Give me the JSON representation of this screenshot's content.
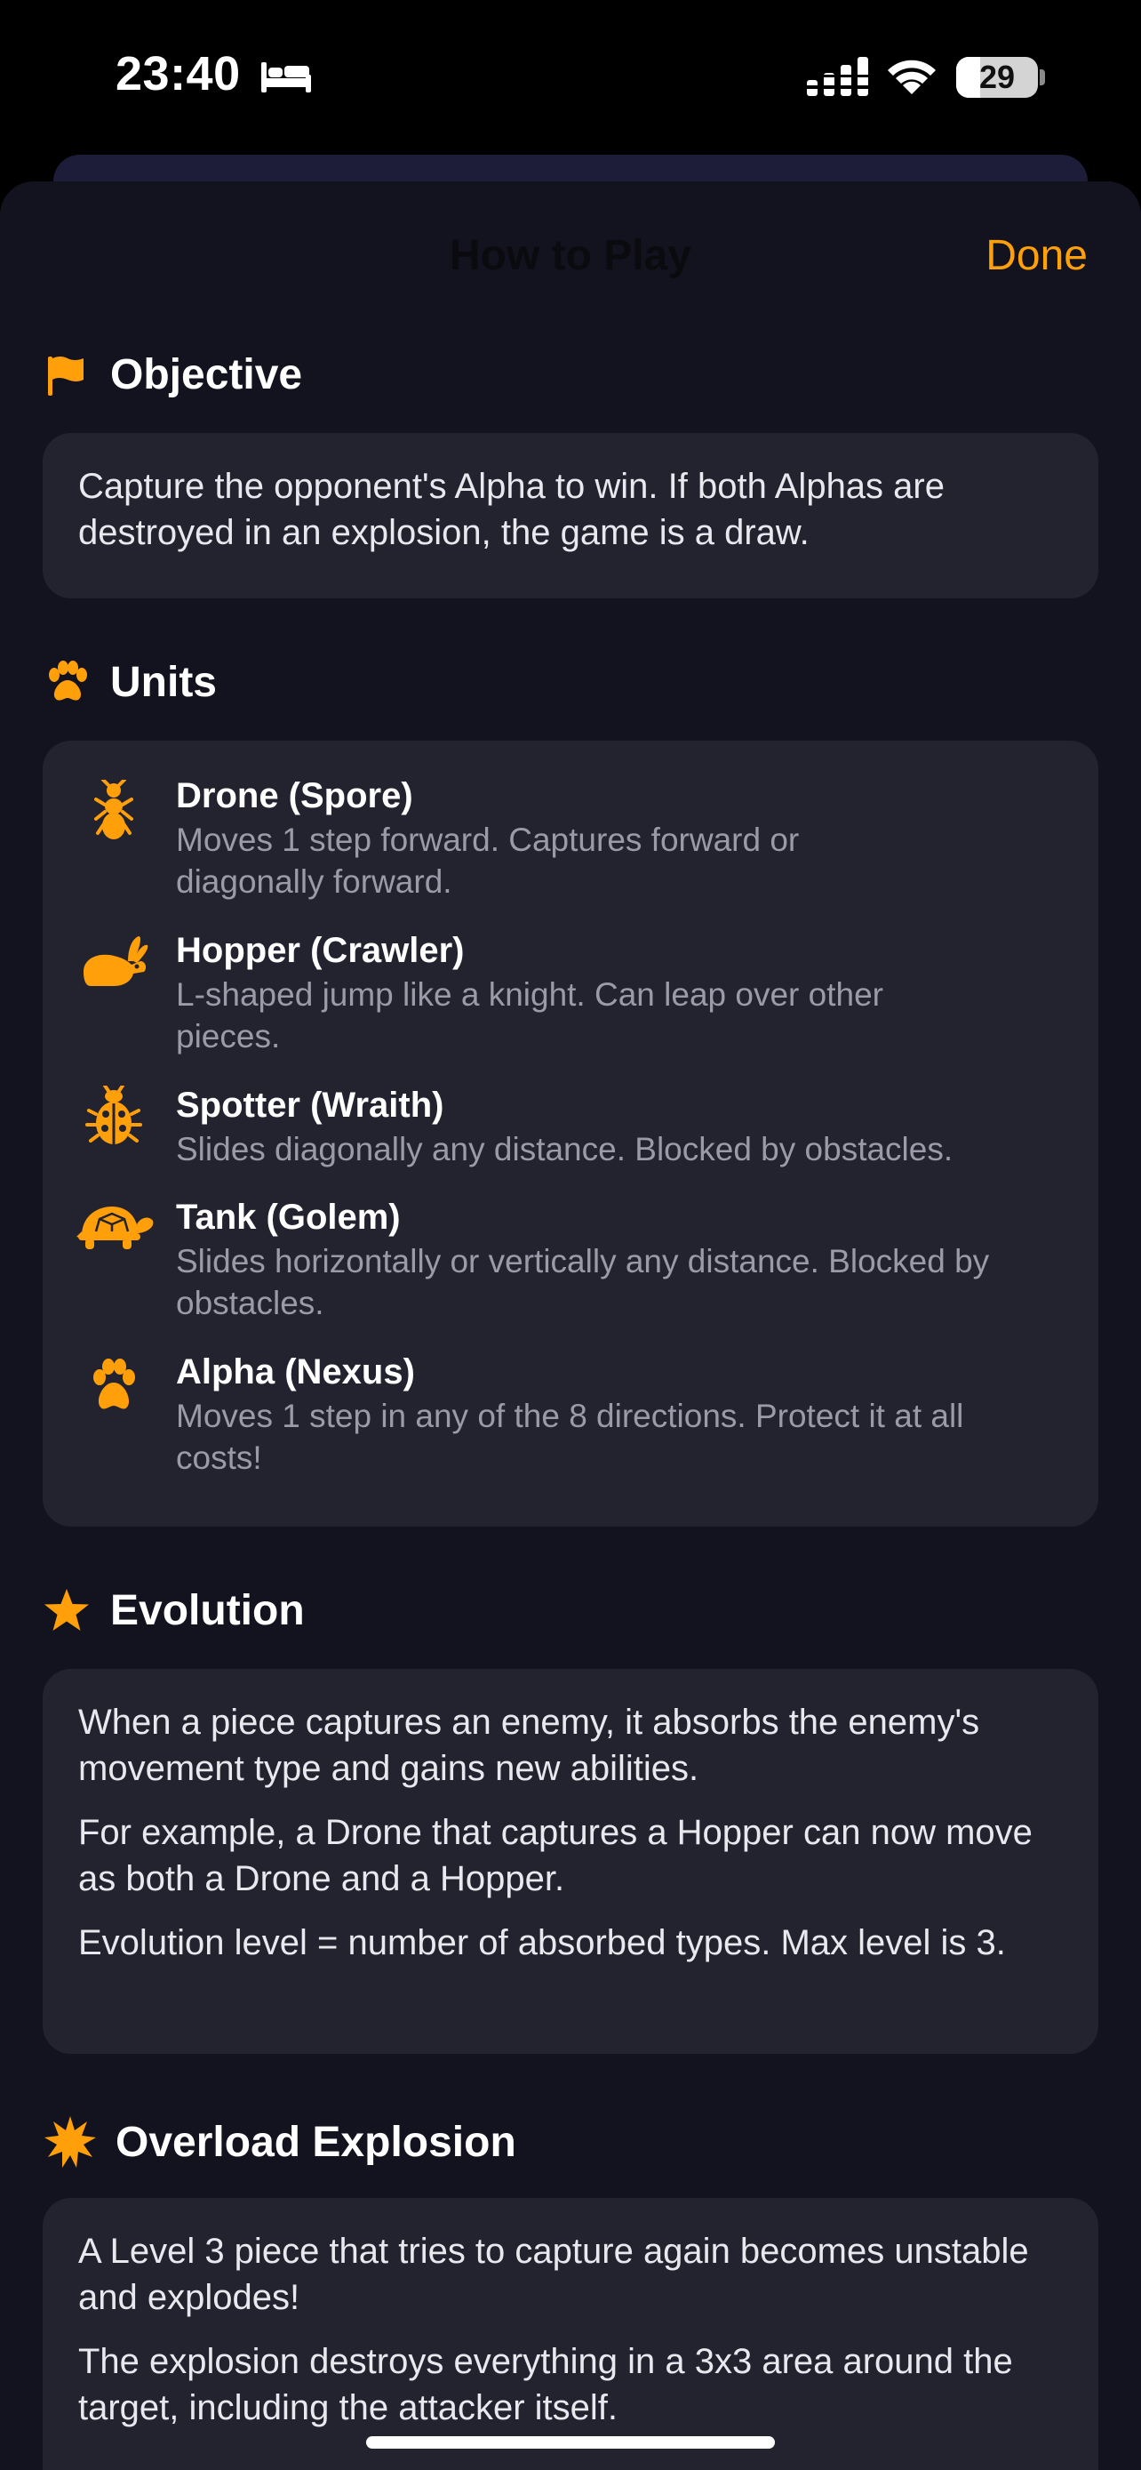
{
  "status_bar": {
    "time": "23:40",
    "battery": "29"
  },
  "nav": {
    "title": "How to Play",
    "done_label": "Done"
  },
  "colors": {
    "accent": "#ff9f0a",
    "sheet_bg": "#13131f",
    "card_bg": "#232330"
  },
  "sections": {
    "objective": {
      "icon": "flag-icon",
      "title": "Objective",
      "paragraphs": [
        "Capture the opponent's Alpha to win. If both Alphas are destroyed in an explosion, the game is a draw."
      ]
    },
    "units": {
      "icon": "paw-icon",
      "title": "Units",
      "items": [
        {
          "icon": "ant-icon",
          "name": "Drone (Spore)",
          "desc": "Moves 1 step forward. Captures forward or diagonally forward."
        },
        {
          "icon": "hare-icon",
          "name": "Hopper (Crawler)",
          "desc": "L-shaped jump like a knight. Can leap over other pieces."
        },
        {
          "icon": "ladybug-icon",
          "name": "Spotter (Wraith)",
          "desc": "Slides diagonally any distance. Blocked by obstacles."
        },
        {
          "icon": "tortoise-icon",
          "name": "Tank (Golem)",
          "desc": "Slides horizontally or vertically any distance. Blocked by obstacles."
        },
        {
          "icon": "paw-icon",
          "name": "Alpha (Nexus)",
          "desc": "Moves 1 step in any of the 8 directions. Protect it at all costs!"
        }
      ]
    },
    "evolution": {
      "icon": "star-icon",
      "title": "Evolution",
      "paragraphs": [
        "When a piece captures an enemy, it absorbs the enemy's movement type and gains new abilities.",
        "For example, a Drone that captures a Hopper can now move as both a Drone and a Hopper.",
        "Evolution level = number of absorbed types. Max level is 3."
      ]
    },
    "overload": {
      "icon": "burst-icon",
      "title": "Overload Explosion",
      "paragraphs": [
        "A Level 3 piece that tries to capture again becomes unstable and explodes!",
        "The explosion destroys everything in a 3x3 area around the target, including the attacker itself."
      ]
    }
  }
}
